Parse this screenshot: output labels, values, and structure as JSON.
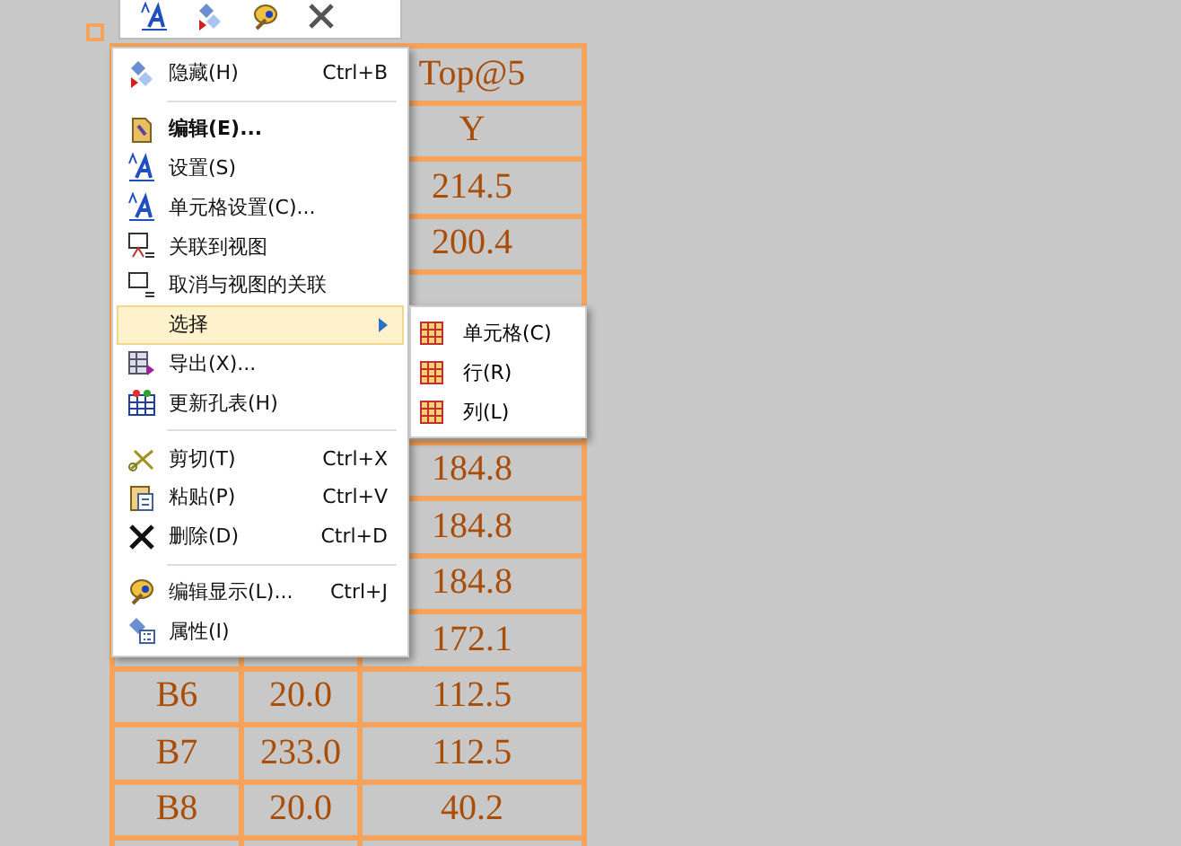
{
  "table": {
    "rows": [
      {
        "column_3": "Top@5"
      },
      {
        "column_3": "Y"
      },
      {
        "column_3": "214.5"
      },
      {
        "column_3": "200.4"
      },
      {},
      {},
      {},
      {
        "column_3": "184.8"
      },
      {
        "column_3": "184.8"
      },
      {
        "column_3": "184.8"
      },
      {
        "column_3": "172.1"
      },
      {
        "column_1": "B6",
        "column_2": "20.0",
        "column_3": "112.5"
      },
      {
        "column_1": "B7",
        "column_2": "233.0",
        "column_3": "112.5"
      },
      {
        "column_1": "B8",
        "column_2": "20.0",
        "column_3": "40.2"
      },
      {}
    ]
  },
  "menu": {
    "items": [
      {
        "kind": "item",
        "label": "隐藏(H)",
        "shortcut": "Ctrl+B",
        "selected": false,
        "default": false
      },
      {
        "kind": "separator"
      },
      {
        "kind": "item",
        "label": "编辑(E)...",
        "selected": false,
        "default": true
      },
      {
        "kind": "item",
        "label": "设置(S)",
        "selected": false,
        "default": false
      },
      {
        "kind": "item",
        "label": "单元格设置(C)...",
        "selected": false,
        "default": false
      },
      {
        "kind": "item",
        "label": "关联到视图",
        "selected": false,
        "default": false
      },
      {
        "kind": "item",
        "label": "取消与视图的关联",
        "selected": false,
        "default": false
      },
      {
        "kind": "item",
        "label": "选择",
        "selected": true,
        "default": false,
        "submenu": [
          {
            "label": "单元格(C)"
          },
          {
            "label": "行(R)"
          },
          {
            "label": "列(L)"
          }
        ]
      },
      {
        "kind": "item",
        "label": "导出(X)...",
        "selected": false,
        "default": false
      },
      {
        "kind": "item",
        "label": "更新孔表(H)",
        "selected": false,
        "default": false
      },
      {
        "kind": "separator"
      },
      {
        "kind": "item",
        "label": "剪切(T)",
        "shortcut": "Ctrl+X",
        "selected": false,
        "default": false
      },
      {
        "kind": "item",
        "label": "粘贴(P)",
        "shortcut": "Ctrl+V",
        "selected": false,
        "default": false
      },
      {
        "kind": "item",
        "label": "删除(D)",
        "shortcut": "Ctrl+D",
        "selected": false,
        "default": false
      },
      {
        "kind": "separator"
      },
      {
        "kind": "item",
        "label": "编辑显示(L)...",
        "shortcut": "Ctrl+J",
        "selected": false,
        "default": false
      },
      {
        "kind": "item",
        "label": "属性(I)",
        "selected": false,
        "default": false
      }
    ]
  }
}
